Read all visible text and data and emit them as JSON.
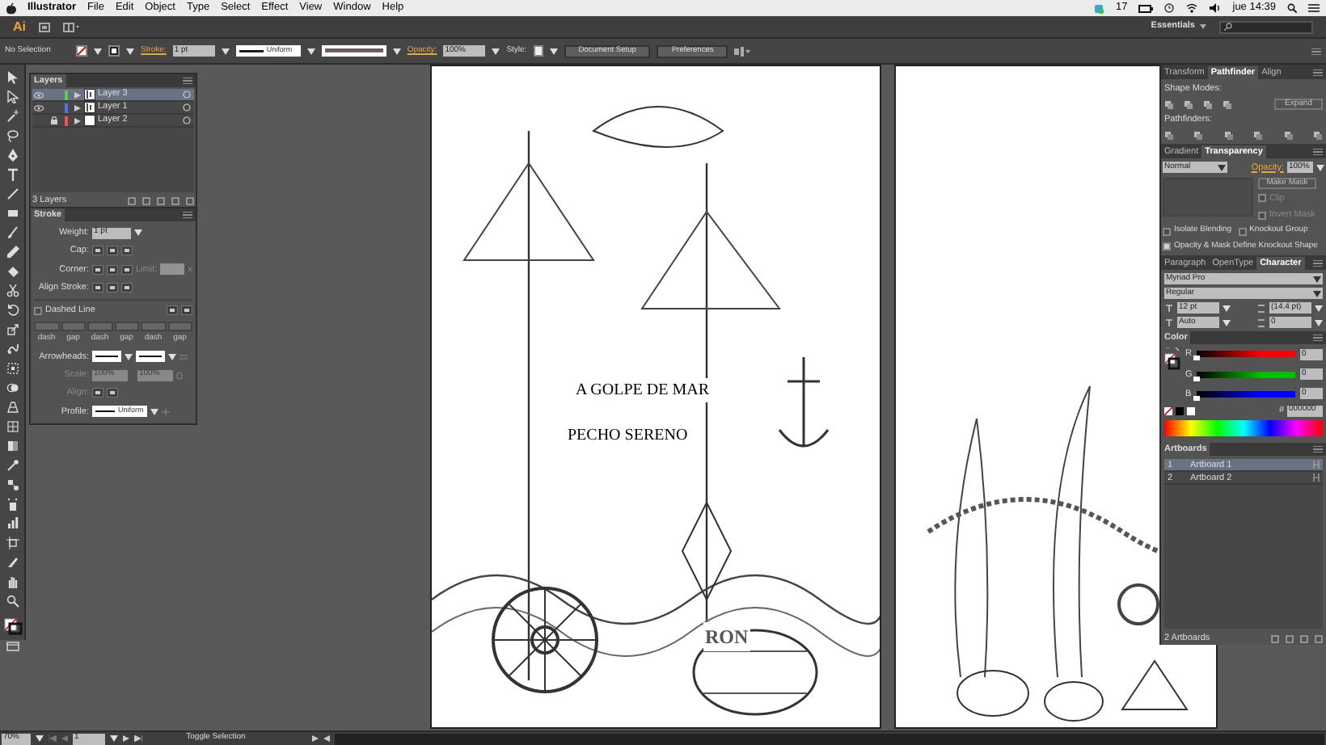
{
  "menu_bar": {
    "app": "Illustrator",
    "items": [
      "File",
      "Edit",
      "Object",
      "Type",
      "Select",
      "Effect",
      "View",
      "Window",
      "Help"
    ],
    "badge": "17",
    "clock": "jue 14:39"
  },
  "app_bar": {
    "logo": "Ai",
    "workspace": "Essentials"
  },
  "control_bar": {
    "selection": "No Selection",
    "stroke_label": "Stroke:",
    "stroke_weight": "1 pt",
    "profile": "Uniform",
    "opacity_label": "Opacity:",
    "opacity": "100%",
    "style_label": "Style:",
    "buttons": [
      "Document Setup",
      "Preferences"
    ]
  },
  "layers": {
    "title": "Layers",
    "footer": "3 Layers",
    "rows": [
      {
        "name": "Layer 3",
        "color": "#4fd34f",
        "visible": true,
        "locked": false,
        "selected": true
      },
      {
        "name": "Layer 1",
        "color": "#4f6fff",
        "visible": true,
        "locked": false,
        "selected": false
      },
      {
        "name": "Layer 2",
        "color": "#ff4a4a",
        "visible": false,
        "locked": true,
        "selected": false
      }
    ]
  },
  "stroke": {
    "title": "Stroke",
    "weight_label": "Weight:",
    "weight": "1 pt",
    "cap_label": "Cap:",
    "corner_label": "Corner:",
    "limit_label": "Limit:",
    "limit_unit": "x",
    "align_label": "Align Stroke:",
    "dashed": {
      "label": "Dashed Line",
      "checked": false
    },
    "dash_labels": [
      "dash",
      "gap",
      "dash",
      "gap",
      "dash",
      "gap"
    ],
    "arrowheads_label": "Arrowheads:",
    "scale_label": "Scale:",
    "scale_values": [
      "100%",
      "100%"
    ],
    "align_arrows_label": "Align:",
    "profile_label": "Profile:",
    "profile": "Uniform"
  },
  "pathfinder": {
    "tabs": [
      {
        "label": "Transform",
        "selected": false
      },
      {
        "label": "Pathfinder",
        "selected": true
      },
      {
        "label": "Align",
        "selected": false
      }
    ],
    "shape_modes": "Shape Modes:",
    "expand": "Expand",
    "pathfinders": "Pathfinders:"
  },
  "transparency": {
    "tabs": [
      {
        "label": "Gradient",
        "selected": false
      },
      {
        "label": "Transparency",
        "selected": true
      }
    ],
    "blend": "Normal",
    "opacity_label": "Opacity:",
    "opacity": "100%",
    "make_mask": "Make Mask",
    "options": [
      {
        "label": "Clip",
        "checked": false
      },
      {
        "label": "Invert Mask",
        "checked": false
      }
    ],
    "checkboxes": [
      {
        "label": "Isolate Blending",
        "checked": false
      },
      {
        "label": "Knockout Group",
        "checked": false
      },
      {
        "label": "Opacity & Mask Define Knockout Shape",
        "checked": true
      }
    ]
  },
  "character": {
    "tabs": [
      {
        "label": "Paragraph",
        "selected": false
      },
      {
        "label": "OpenType",
        "selected": false
      },
      {
        "label": "Character",
        "selected": true
      }
    ],
    "font": "Myriad Pro",
    "style": "Regular",
    "size": "12 pt",
    "leading": "(14.4 pt)",
    "kerning": "Auto",
    "tracking": "0"
  },
  "color": {
    "title": "Color",
    "channels": [
      {
        "label": "R",
        "value": "0",
        "level": 0,
        "color": "#ff0000"
      },
      {
        "label": "G",
        "value": "0",
        "level": 0,
        "color": "#00c000"
      },
      {
        "label": "B",
        "value": "0",
        "level": 0,
        "color": "#0000ff"
      }
    ],
    "hex_label": "#",
    "hex": "000000"
  },
  "artboards": {
    "title": "Artboards",
    "rows": [
      {
        "number": "1",
        "name": "Artboard 1",
        "selected": true
      },
      {
        "number": "2",
        "name": "Artboard 2",
        "selected": false
      }
    ],
    "footer": "2 Artboards"
  },
  "artwork": {
    "texts": [
      "A GOLPE DE MAR",
      "PECHO SERENO",
      "RON"
    ]
  },
  "status_bar": {
    "zoom": "70%",
    "page": "1",
    "message": "Toggle Selection"
  }
}
